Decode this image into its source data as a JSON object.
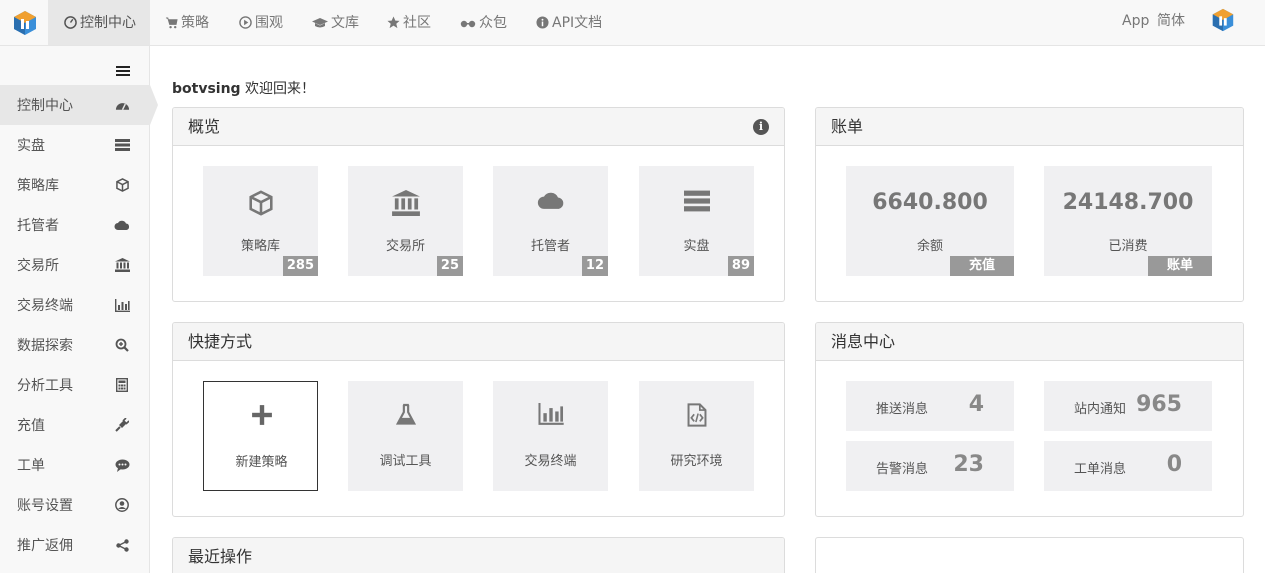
{
  "topnav": {
    "items": [
      {
        "label": "控制中心",
        "icon": "dashboard-icon"
      },
      {
        "label": "策略",
        "icon": "cart-icon"
      },
      {
        "label": "围观",
        "icon": "play-circle-icon"
      },
      {
        "label": "文库",
        "icon": "graduation-cap-icon"
      },
      {
        "label": "社区",
        "icon": "star-icon"
      },
      {
        "label": "众包",
        "icon": "glasses-icon"
      },
      {
        "label": "API文档",
        "icon": "info-circle-icon"
      }
    ],
    "app_label": "App",
    "lang_label": "简体"
  },
  "sidebar": {
    "items": [
      {
        "label": "控制中心",
        "icon": "dashboard-icon"
      },
      {
        "label": "实盘",
        "icon": "server-icon"
      },
      {
        "label": "策略库",
        "icon": "cube-icon"
      },
      {
        "label": "托管者",
        "icon": "cloud-icon"
      },
      {
        "label": "交易所",
        "icon": "bank-icon"
      },
      {
        "label": "交易终端",
        "icon": "bar-chart-icon"
      },
      {
        "label": "数据探索",
        "icon": "search-plus-icon"
      },
      {
        "label": "分析工具",
        "icon": "calculator-icon"
      },
      {
        "label": "充值",
        "icon": "plug-icon"
      },
      {
        "label": "工单",
        "icon": "comment-icon"
      },
      {
        "label": "账号设置",
        "icon": "user-circle-icon"
      },
      {
        "label": "推广返佣",
        "icon": "share-icon"
      }
    ]
  },
  "welcome": {
    "username": "botvsing",
    "message": "欢迎回来！"
  },
  "overview": {
    "title": "概览",
    "tiles": [
      {
        "label": "策略库",
        "count": "285",
        "icon": "cube-icon"
      },
      {
        "label": "交易所",
        "count": "25",
        "icon": "bank-icon"
      },
      {
        "label": "托管者",
        "count": "12",
        "icon": "cloud-icon"
      },
      {
        "label": "实盘",
        "count": "89",
        "icon": "server-icon"
      }
    ]
  },
  "billing": {
    "title": "账单",
    "balance": {
      "amount": "6640.800",
      "label": "余额",
      "button": "充值"
    },
    "spent": {
      "amount": "24148.700",
      "label": "已消费",
      "button": "账单"
    }
  },
  "shortcuts": {
    "title": "快捷方式",
    "tiles": [
      {
        "label": "新建策略",
        "icon": "plus-icon"
      },
      {
        "label": "调试工具",
        "icon": "flask-icon"
      },
      {
        "label": "交易终端",
        "icon": "bar-chart-icon"
      },
      {
        "label": "研究环境",
        "icon": "code-file-icon"
      }
    ]
  },
  "messages": {
    "title": "消息中心",
    "items": [
      {
        "label": "推送消息",
        "count": "4"
      },
      {
        "label": "站内通知",
        "count": "965"
      },
      {
        "label": "告警消息",
        "count": "23"
      },
      {
        "label": "工单消息",
        "count": "0"
      }
    ]
  },
  "recent": {
    "title": "最近操作"
  }
}
